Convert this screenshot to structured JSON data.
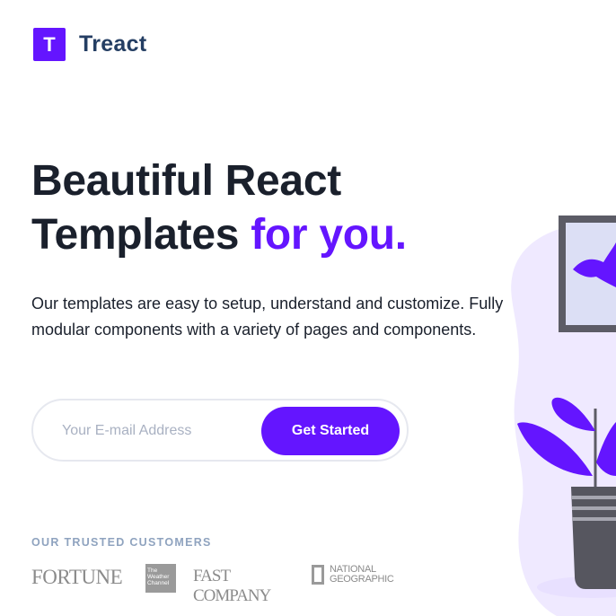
{
  "brand": {
    "logo_letter": "T",
    "name": "Treact"
  },
  "hero": {
    "title_line1": "Beautiful React",
    "title_line2_main": "Templates",
    "title_line2_accent": "for you.",
    "description": "Our templates are easy to setup, understand and customize. Fully modular components with a variety of pages and components."
  },
  "signup": {
    "email_placeholder": "Your E-mail Address",
    "email_value": "",
    "button_label": "Get Started"
  },
  "customers": {
    "label": "OUR TRUSTED CUSTOMERS",
    "logos": {
      "fortune": "FORTUNE",
      "weather_line1": "The",
      "weather_line2": "Weather",
      "weather_line3": "Channel",
      "fastcompany": "FAST COMPANY",
      "natgeo_line1": "NATIONAL",
      "natgeo_line2": "GEOGRAPHIC"
    }
  },
  "colors": {
    "primary": "#6415ff",
    "heading": "#1a202c",
    "logo_text": "#243e63",
    "muted_label": "#8fa3bf",
    "illustration_bg": "#efe9ff"
  }
}
